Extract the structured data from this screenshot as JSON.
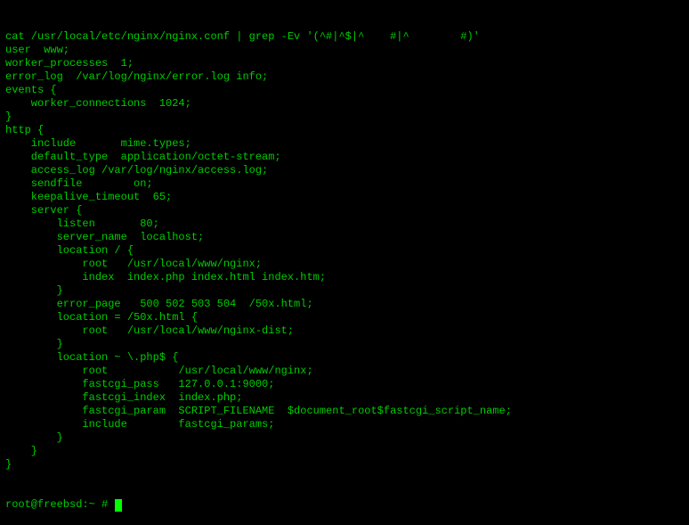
{
  "terminal": {
    "lines": [
      "cat /usr/local/etc/nginx/nginx.conf | grep -Ev '(^#|^$|^    #|^        #)'",
      "user  www;",
      "worker_processes  1;",
      "error_log  /var/log/nginx/error.log info;",
      "events {",
      "    worker_connections  1024;",
      "}",
      "http {",
      "    include       mime.types;",
      "    default_type  application/octet-stream;",
      "    access_log /var/log/nginx/access.log;",
      "    sendfile        on;",
      "    keepalive_timeout  65;",
      "    server {",
      "        listen       80;",
      "        server_name  localhost;",
      "        location / {",
      "            root   /usr/local/www/nginx;",
      "            index  index.php index.html index.htm;",
      "        }",
      "        error_page   500 502 503 504  /50x.html;",
      "        location = /50x.html {",
      "            root   /usr/local/www/nginx-dist;",
      "        }",
      "        location ~ \\.php$ {",
      "            root           /usr/local/www/nginx;",
      "            fastcgi_pass   127.0.0.1:9000;",
      "            fastcgi_index  index.php;",
      "            fastcgi_param  SCRIPT_FILENAME  $document_root$fastcgi_script_name;",
      "            include        fastcgi_params;",
      "        }",
      "    }",
      "}"
    ],
    "prompt": "root@freebsd:~ # "
  }
}
